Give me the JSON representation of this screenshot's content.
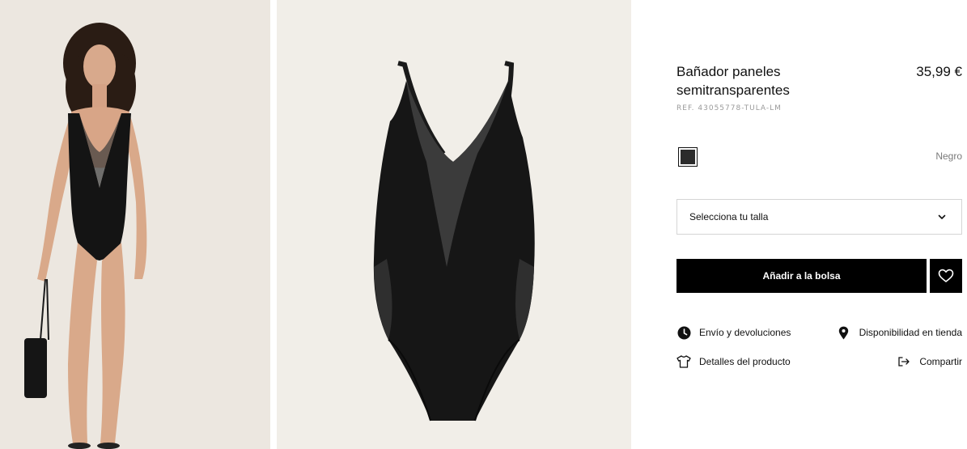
{
  "product": {
    "title": "Bañador paneles semitransparentes",
    "price": "35,99 €",
    "ref": "REF. 43055778-TULA-LM",
    "color": {
      "name": "Negro",
      "swatch": "#2b2b2b"
    }
  },
  "size_select": {
    "label": "Selecciona tu talla"
  },
  "actions": {
    "add_to_bag": "Añadir a la bolsa",
    "favorite_icon": "heart-icon"
  },
  "links": {
    "shipping": {
      "label": "Envío y devoluciones",
      "icon": "clock-icon"
    },
    "availability": {
      "label": "Disponibilidad en tienda",
      "icon": "location-pin-icon"
    },
    "details": {
      "label": "Detalles del producto",
      "icon": "tshirt-icon"
    },
    "share": {
      "label": "Compartir",
      "icon": "share-icon"
    }
  },
  "colors": {
    "primary": "#000000",
    "border": "#d5d5d5",
    "muted": "#7a7a7a"
  }
}
